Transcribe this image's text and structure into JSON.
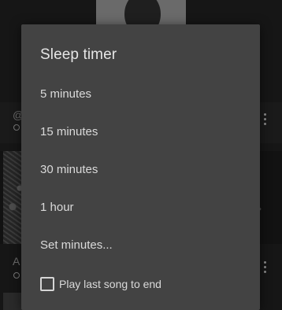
{
  "background": {
    "row1_text": "@",
    "row2_text": "A"
  },
  "dialog": {
    "title": "Sleep timer",
    "options": [
      {
        "label": "5 minutes"
      },
      {
        "label": "15 minutes"
      },
      {
        "label": "30 minutes"
      },
      {
        "label": "1 hour"
      },
      {
        "label": "Set minutes..."
      }
    ],
    "checkbox": {
      "label": "Play last song to end",
      "checked": false
    }
  }
}
